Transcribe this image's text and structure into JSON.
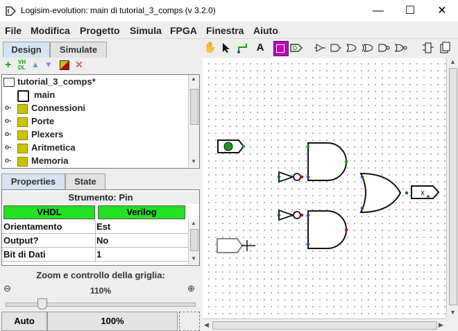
{
  "window": {
    "title": "Logisim-evolution: main di tutorial_3_comps (v 3.2.0)",
    "minimize": "—",
    "maximize": "☐",
    "close": "✕"
  },
  "menu": [
    "File",
    "Modifica",
    "Progetto",
    "Simula",
    "FPGA",
    "Finestra",
    "Aiuto"
  ],
  "top_tabs": {
    "design": "Design",
    "simulate": "Simulate"
  },
  "tree": {
    "project": "tutorial_3_comps*",
    "main": "main",
    "folders": [
      "Connessioni",
      "Porte",
      "Plexers",
      "Aritmetica",
      "Memoria"
    ]
  },
  "bottom_tabs": {
    "properties": "Properties",
    "state": "State"
  },
  "properties": {
    "tool_label": "Strumento: Pin",
    "hdl": [
      "VHDL",
      "Verilog"
    ],
    "rows": [
      {
        "name": "Orientamento",
        "value": "Est"
      },
      {
        "name": "Output?",
        "value": "No"
      },
      {
        "name": "Bit di Dati",
        "value": "1"
      }
    ]
  },
  "zoom": {
    "label": "Zoom e controllo della griglia:",
    "value": "110%",
    "auto_button": "Auto",
    "reset_button": "100%",
    "slider_fraction": 0.11
  },
  "toolbar": {
    "icons": [
      "hand-icon",
      "pointer-icon",
      "wire-icon",
      "text-icon",
      "input-pin-icon",
      "output-pin-icon",
      "buffer-icon",
      "and-gate-icon",
      "or-gate-icon",
      "xor-gate-icon",
      "nand-gate-icon",
      "nor-gate-icon",
      "layout-icon",
      "appearance-icon"
    ],
    "text_tool": "A"
  },
  "circuit": {
    "input_value": "0",
    "output_value": "x"
  },
  "colors": {
    "selected_tool": "#c000c0",
    "hdl_green": "#22e022",
    "wire_green": "#00a000",
    "pin_blue": "#2040d0",
    "pin_red": "#d00000"
  }
}
